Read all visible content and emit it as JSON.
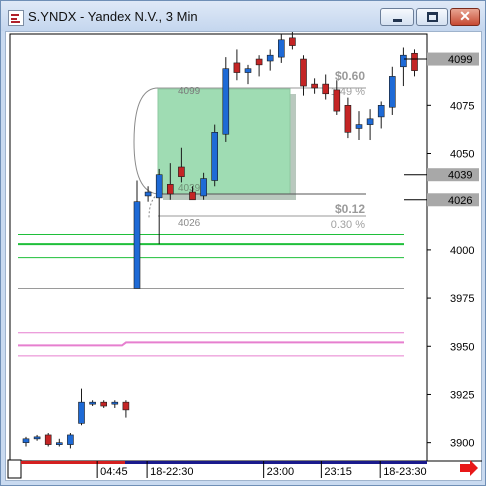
{
  "window": {
    "title": "S.YNDX - Yandex N.V., 3 Min",
    "buttons": {
      "minimize": "minimize",
      "maximize": "maximize",
      "close": "✕"
    }
  },
  "chart_data": {
    "type": "candlestick",
    "symbol": "S.YNDX",
    "instrument": "Yandex N.V.",
    "interval": "3 Min",
    "ylim": [
      3891,
      4112
    ],
    "y_ticks": [
      3900,
      3925,
      3950,
      3975,
      4000,
      4025,
      4050,
      4075,
      4100
    ],
    "y_tick_labels": [
      "3900",
      "3925",
      "3950",
      "3975",
      "4000",
      "",
      "4050",
      "4075",
      ""
    ],
    "price_markers": [
      {
        "value": 4099,
        "label": "4099"
      },
      {
        "value": 4039,
        "label": "4039"
      },
      {
        "value": 4026,
        "label": "4026"
      }
    ],
    "x_labels": [
      {
        "label": "04:45",
        "slot": 6.5
      },
      {
        "label": "18-22:30",
        "slot": 11
      },
      {
        "label": "23:00",
        "slot": 21.5
      },
      {
        "label": "23:15",
        "slot": 26.7
      },
      {
        "label": "18-23:30",
        "slot": 32
      }
    ],
    "candles": [
      {
        "slot": 0,
        "o": 3900,
        "h": 3903,
        "l": 3898,
        "c": 3902
      },
      {
        "slot": 1,
        "o": 3902,
        "h": 3904,
        "l": 3901,
        "c": 3903
      },
      {
        "slot": 2,
        "o": 3904,
        "h": 3905,
        "l": 3898,
        "c": 3899
      },
      {
        "slot": 3,
        "o": 3899,
        "h": 3902,
        "l": 3898,
        "c": 3900
      },
      {
        "slot": 4,
        "o": 3899,
        "h": 3905,
        "l": 3897,
        "c": 3904
      },
      {
        "slot": 5,
        "o": 3910,
        "h": 3928,
        "l": 3909,
        "c": 3921
      },
      {
        "slot": 6,
        "o": 3920,
        "h": 3922,
        "l": 3919,
        "c": 3921
      },
      {
        "slot": 7,
        "o": 3921,
        "h": 3922,
        "l": 3918,
        "c": 3919
      },
      {
        "slot": 8,
        "o": 3920,
        "h": 3922,
        "l": 3918,
        "c": 3921
      },
      {
        "slot": 9,
        "o": 3921,
        "h": 3922,
        "l": 3913,
        "c": 3917
      },
      {
        "slot": 10,
        "o": 3980,
        "h": 4036,
        "l": 3980,
        "c": 4025
      },
      {
        "slot": 11,
        "o": 4028,
        "h": 4033,
        "l": 4025,
        "c": 4030
      },
      {
        "slot": 12,
        "o": 4027,
        "h": 4042,
        "l": 4003,
        "c": 4039
      },
      {
        "slot": 13,
        "o": 4034,
        "h": 4045,
        "l": 4026,
        "c": 4029
      },
      {
        "slot": 14,
        "o": 4043,
        "h": 4053,
        "l": 4035,
        "c": 4038
      },
      {
        "slot": 15,
        "o": 4030,
        "h": 4033,
        "l": 4026,
        "c": 4026
      },
      {
        "slot": 16,
        "o": 4028,
        "h": 4040,
        "l": 4026,
        "c": 4037
      },
      {
        "slot": 17,
        "o": 4036,
        "h": 4065,
        "l": 4033,
        "c": 4061
      },
      {
        "slot": 18,
        "o": 4060,
        "h": 4100,
        "l": 4056,
        "c": 4094
      },
      {
        "slot": 19,
        "o": 4097,
        "h": 4104,
        "l": 4088,
        "c": 4092
      },
      {
        "slot": 20,
        "o": 4092,
        "h": 4096,
        "l": 4086,
        "c": 4094
      },
      {
        "slot": 21,
        "o": 4099,
        "h": 4101,
        "l": 4090,
        "c": 4096
      },
      {
        "slot": 22,
        "o": 4098,
        "h": 4104,
        "l": 4093,
        "c": 4101
      },
      {
        "slot": 23,
        "o": 4100,
        "h": 4112,
        "l": 4097,
        "c": 4109
      },
      {
        "slot": 24,
        "o": 4110,
        "h": 4115,
        "l": 4104,
        "c": 4106
      },
      {
        "slot": 25,
        "o": 4099,
        "h": 4101,
        "l": 4080,
        "c": 4085
      },
      {
        "slot": 26,
        "o": 4086,
        "h": 4089,
        "l": 4081,
        "c": 4084
      },
      {
        "slot": 27,
        "o": 4086,
        "h": 4091,
        "l": 4078,
        "c": 4081
      },
      {
        "slot": 28,
        "o": 4083,
        "h": 4088,
        "l": 4070,
        "c": 4072
      },
      {
        "slot": 29,
        "o": 4075,
        "h": 4079,
        "l": 4058,
        "c": 4061
      },
      {
        "slot": 30,
        "o": 4063,
        "h": 4072,
        "l": 4057,
        "c": 4065
      },
      {
        "slot": 31,
        "o": 4065,
        "h": 4073,
        "l": 4057,
        "c": 4068
      },
      {
        "slot": 32,
        "o": 4069,
        "h": 4077,
        "l": 4063,
        "c": 4075
      },
      {
        "slot": 33,
        "o": 4074,
        "h": 4095,
        "l": 4070,
        "c": 4090
      },
      {
        "slot": 34,
        "o": 4095,
        "h": 4105,
        "l": 4085,
        "c": 4101
      },
      {
        "slot": 35,
        "o": 4102,
        "h": 4104,
        "l": 4090,
        "c": 4093
      }
    ],
    "horizontal_lines": [
      {
        "value": 4003,
        "color": "#1fbf3a",
        "style": "solid"
      },
      {
        "value": 4008,
        "color": "#1fbf3a",
        "style": "thin"
      },
      {
        "value": 3996,
        "color": "#1fbf3a",
        "style": "thin"
      },
      {
        "value": 3980,
        "color": "#9a9a9a",
        "style": "thin"
      },
      {
        "value": 3952,
        "color": "#e67fcf",
        "style": "solid"
      },
      {
        "value": 3957,
        "color": "#e67fcf",
        "style": "thin"
      },
      {
        "value": 3945,
        "color": "#e67fcf",
        "style": "thin"
      }
    ],
    "measure_tool": {
      "upper_price": "4099",
      "lower_price": "4039",
      "base_price": "4026",
      "upper_change": "$0.60",
      "upper_pct": "1.49 %",
      "lower_change": "$0.12",
      "lower_pct": "0.30 %"
    },
    "colors": {
      "up": "#1e6ad6",
      "down": "#c42525",
      "background": "#ffffff",
      "grid": "#000000",
      "green_zone": "#9fdcb3",
      "nav_arrow": "#e81818",
      "time_bar_red": "#d42020",
      "time_bar_blue": "#1a1a8c"
    }
  }
}
